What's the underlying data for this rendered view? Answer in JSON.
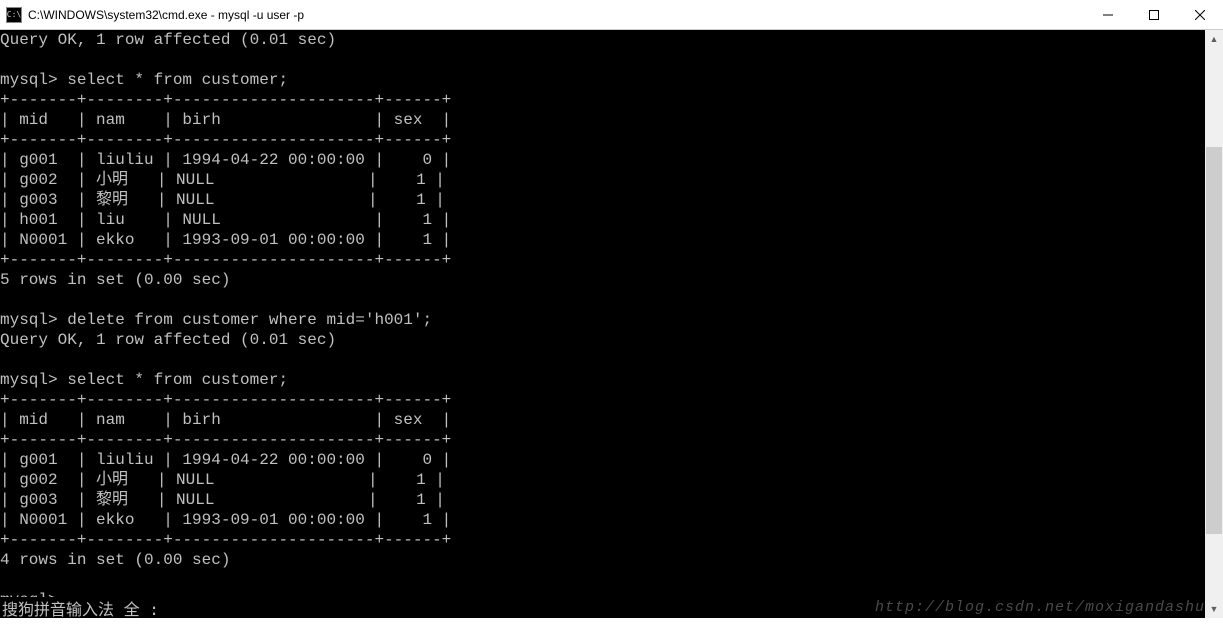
{
  "window": {
    "title": "C:\\WINDOWS\\system32\\cmd.exe - mysql  -u user -p",
    "icon_label": "C:\\"
  },
  "terminal": {
    "line_query_ok_1": "Query OK, 1 row affected (0.01 sec)",
    "blank": "",
    "prompt_select_1": "mysql> select * from customer;",
    "tbl_border_top": "+-------+--------+---------------------+------+",
    "tbl_header": "| mid   | nam    | birh                | sex  |",
    "tbl_border_mid": "+-------+--------+---------------------+------+",
    "tbl1_rows": [
      "| g001  | liuliu | 1994-04-22 00:00:00 |    0 |",
      "| g002  | 小明   | NULL                |    1 |",
      "| g003  | 黎明   | NULL                |    1 |",
      "| h001  | liu    | NULL                |    1 |",
      "| N0001 | ekko   | 1993-09-01 00:00:00 |    1 |"
    ],
    "tbl_border_bot": "+-------+--------+---------------------+------+",
    "rows_in_set_5": "5 rows in set (0.00 sec)",
    "prompt_delete": "mysql> delete from customer where mid='h001';",
    "line_query_ok_2": "Query OK, 1 row affected (0.01 sec)",
    "prompt_select_2": "mysql> select * from customer;",
    "tbl2_rows": [
      "| g001  | liuliu | 1994-04-22 00:00:00 |    0 |",
      "| g002  | 小明   | NULL                |    1 |",
      "| g003  | 黎明   | NULL                |    1 |",
      "| N0001 | ekko   | 1993-09-01 00:00:00 |    1 |"
    ],
    "rows_in_set_4": "4 rows in set (0.00 sec)",
    "prompt_empty": "mysql> ",
    "table1_data": {
      "columns": [
        "mid",
        "nam",
        "birh",
        "sex"
      ],
      "rows": [
        {
          "mid": "g001",
          "nam": "liuliu",
          "birh": "1994-04-22 00:00:00",
          "sex": 0
        },
        {
          "mid": "g002",
          "nam": "小明",
          "birh": null,
          "sex": 1
        },
        {
          "mid": "g003",
          "nam": "黎明",
          "birh": null,
          "sex": 1
        },
        {
          "mid": "h001",
          "nam": "liu",
          "birh": null,
          "sex": 1
        },
        {
          "mid": "N0001",
          "nam": "ekko",
          "birh": "1993-09-01 00:00:00",
          "sex": 1
        }
      ]
    },
    "table2_data": {
      "columns": [
        "mid",
        "nam",
        "birh",
        "sex"
      ],
      "rows": [
        {
          "mid": "g001",
          "nam": "liuliu",
          "birh": "1994-04-22 00:00:00",
          "sex": 0
        },
        {
          "mid": "g002",
          "nam": "小明",
          "birh": null,
          "sex": 1
        },
        {
          "mid": "g003",
          "nam": "黎明",
          "birh": null,
          "sex": 1
        },
        {
          "mid": "N0001",
          "nam": "ekko",
          "birh": "1993-09-01 00:00:00",
          "sex": 1
        }
      ]
    }
  },
  "ime": {
    "text": "搜狗拼音输入法 全 :"
  },
  "watermark": {
    "text": "http://blog.csdn.net/moxigandashu"
  },
  "scrollbar": {
    "thumb_top_pct": 18,
    "thumb_height_pct": 70
  }
}
